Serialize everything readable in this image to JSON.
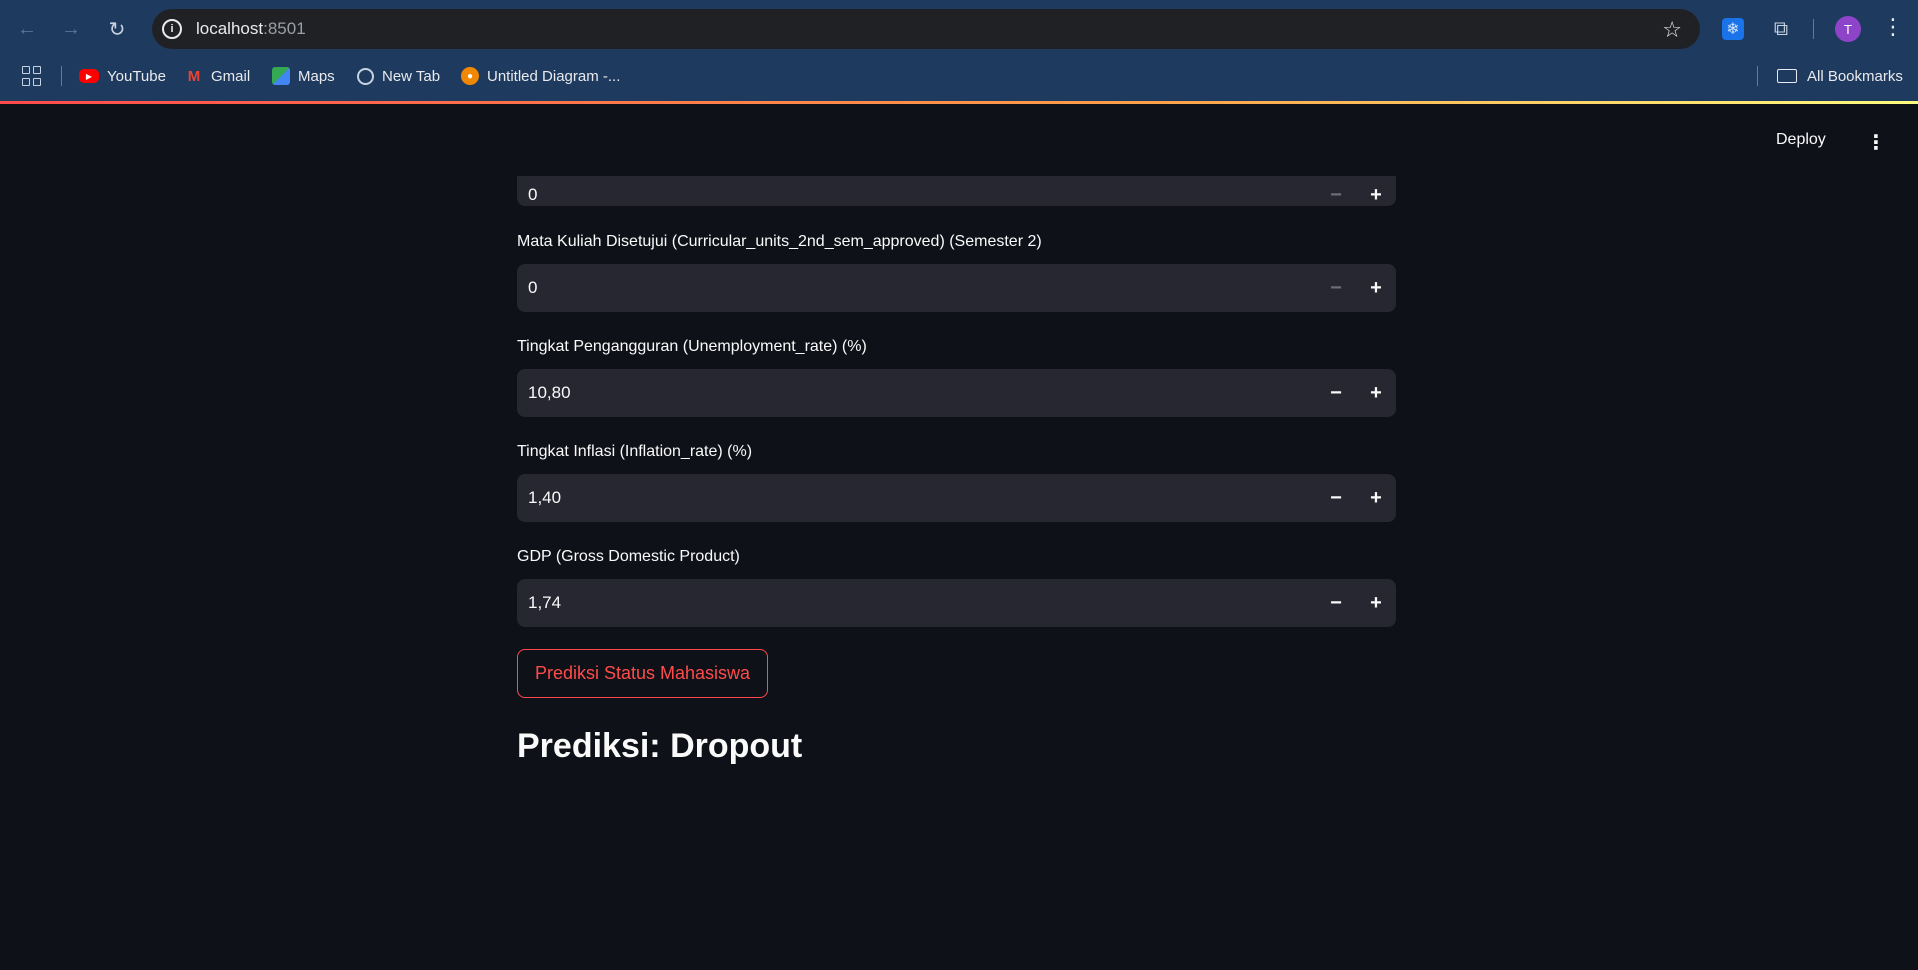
{
  "browser": {
    "url_host": "localhost",
    "url_port": ":8501",
    "avatar_letter": "T",
    "bookmarks": [
      {
        "label": "YouTube",
        "icon": "youtube-icon"
      },
      {
        "label": "Gmail",
        "icon": "gmail-icon"
      },
      {
        "label": "Maps",
        "icon": "maps-icon"
      },
      {
        "label": "New Tab",
        "icon": "globe-icon"
      },
      {
        "label": "Untitled Diagram -...",
        "icon": "drawio-icon"
      }
    ],
    "all_bookmarks_label": "All Bookmarks"
  },
  "app": {
    "deploy_label": "Deploy",
    "fields": [
      {
        "label": "",
        "value": "0"
      },
      {
        "label": "Mata Kuliah Disetujui (Curricular_units_2nd_sem_approved) (Semester 2)",
        "value": "0"
      },
      {
        "label": "Tingkat Pengangguran (Unemployment_rate) (%)",
        "value": "10,80"
      },
      {
        "label": "Tingkat Inflasi (Inflation_rate) (%)",
        "value": "1,40"
      },
      {
        "label": "GDP (Gross Domestic Product)",
        "value": "1,74"
      }
    ],
    "predict_button_label": "Prediksi Status Mahasiswa",
    "result_text": "Prediksi: Dropout"
  },
  "colors": {
    "accent": "#ff4b4b",
    "background": "#0e1117",
    "input_bg": "#262730",
    "chrome": "#1f3a5f"
  }
}
